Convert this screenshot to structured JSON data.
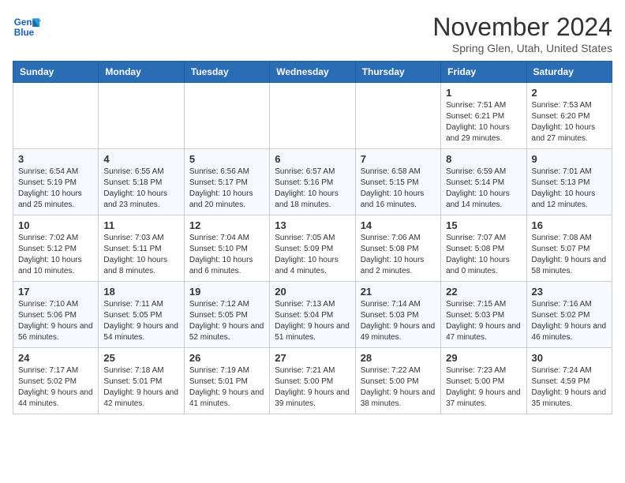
{
  "header": {
    "logo_line1": "General",
    "logo_line2": "Blue",
    "month": "November 2024",
    "location": "Spring Glen, Utah, United States"
  },
  "days_of_week": [
    "Sunday",
    "Monday",
    "Tuesday",
    "Wednesday",
    "Thursday",
    "Friday",
    "Saturday"
  ],
  "weeks": [
    [
      {
        "day": "",
        "info": ""
      },
      {
        "day": "",
        "info": ""
      },
      {
        "day": "",
        "info": ""
      },
      {
        "day": "",
        "info": ""
      },
      {
        "day": "",
        "info": ""
      },
      {
        "day": "1",
        "info": "Sunrise: 7:51 AM\nSunset: 6:21 PM\nDaylight: 10 hours and 29 minutes."
      },
      {
        "day": "2",
        "info": "Sunrise: 7:53 AM\nSunset: 6:20 PM\nDaylight: 10 hours and 27 minutes."
      }
    ],
    [
      {
        "day": "3",
        "info": "Sunrise: 6:54 AM\nSunset: 5:19 PM\nDaylight: 10 hours and 25 minutes."
      },
      {
        "day": "4",
        "info": "Sunrise: 6:55 AM\nSunset: 5:18 PM\nDaylight: 10 hours and 23 minutes."
      },
      {
        "day": "5",
        "info": "Sunrise: 6:56 AM\nSunset: 5:17 PM\nDaylight: 10 hours and 20 minutes."
      },
      {
        "day": "6",
        "info": "Sunrise: 6:57 AM\nSunset: 5:16 PM\nDaylight: 10 hours and 18 minutes."
      },
      {
        "day": "7",
        "info": "Sunrise: 6:58 AM\nSunset: 5:15 PM\nDaylight: 10 hours and 16 minutes."
      },
      {
        "day": "8",
        "info": "Sunrise: 6:59 AM\nSunset: 5:14 PM\nDaylight: 10 hours and 14 minutes."
      },
      {
        "day": "9",
        "info": "Sunrise: 7:01 AM\nSunset: 5:13 PM\nDaylight: 10 hours and 12 minutes."
      }
    ],
    [
      {
        "day": "10",
        "info": "Sunrise: 7:02 AM\nSunset: 5:12 PM\nDaylight: 10 hours and 10 minutes."
      },
      {
        "day": "11",
        "info": "Sunrise: 7:03 AM\nSunset: 5:11 PM\nDaylight: 10 hours and 8 minutes."
      },
      {
        "day": "12",
        "info": "Sunrise: 7:04 AM\nSunset: 5:10 PM\nDaylight: 10 hours and 6 minutes."
      },
      {
        "day": "13",
        "info": "Sunrise: 7:05 AM\nSunset: 5:09 PM\nDaylight: 10 hours and 4 minutes."
      },
      {
        "day": "14",
        "info": "Sunrise: 7:06 AM\nSunset: 5:08 PM\nDaylight: 10 hours and 2 minutes."
      },
      {
        "day": "15",
        "info": "Sunrise: 7:07 AM\nSunset: 5:08 PM\nDaylight: 10 hours and 0 minutes."
      },
      {
        "day": "16",
        "info": "Sunrise: 7:08 AM\nSunset: 5:07 PM\nDaylight: 9 hours and 58 minutes."
      }
    ],
    [
      {
        "day": "17",
        "info": "Sunrise: 7:10 AM\nSunset: 5:06 PM\nDaylight: 9 hours and 56 minutes."
      },
      {
        "day": "18",
        "info": "Sunrise: 7:11 AM\nSunset: 5:05 PM\nDaylight: 9 hours and 54 minutes."
      },
      {
        "day": "19",
        "info": "Sunrise: 7:12 AM\nSunset: 5:05 PM\nDaylight: 9 hours and 52 minutes."
      },
      {
        "day": "20",
        "info": "Sunrise: 7:13 AM\nSunset: 5:04 PM\nDaylight: 9 hours and 51 minutes."
      },
      {
        "day": "21",
        "info": "Sunrise: 7:14 AM\nSunset: 5:03 PM\nDaylight: 9 hours and 49 minutes."
      },
      {
        "day": "22",
        "info": "Sunrise: 7:15 AM\nSunset: 5:03 PM\nDaylight: 9 hours and 47 minutes."
      },
      {
        "day": "23",
        "info": "Sunrise: 7:16 AM\nSunset: 5:02 PM\nDaylight: 9 hours and 46 minutes."
      }
    ],
    [
      {
        "day": "24",
        "info": "Sunrise: 7:17 AM\nSunset: 5:02 PM\nDaylight: 9 hours and 44 minutes."
      },
      {
        "day": "25",
        "info": "Sunrise: 7:18 AM\nSunset: 5:01 PM\nDaylight: 9 hours and 42 minutes."
      },
      {
        "day": "26",
        "info": "Sunrise: 7:19 AM\nSunset: 5:01 PM\nDaylight: 9 hours and 41 minutes."
      },
      {
        "day": "27",
        "info": "Sunrise: 7:21 AM\nSunset: 5:00 PM\nDaylight: 9 hours and 39 minutes."
      },
      {
        "day": "28",
        "info": "Sunrise: 7:22 AM\nSunset: 5:00 PM\nDaylight: 9 hours and 38 minutes."
      },
      {
        "day": "29",
        "info": "Sunrise: 7:23 AM\nSunset: 5:00 PM\nDaylight: 9 hours and 37 minutes."
      },
      {
        "day": "30",
        "info": "Sunrise: 7:24 AM\nSunset: 4:59 PM\nDaylight: 9 hours and 35 minutes."
      }
    ]
  ]
}
